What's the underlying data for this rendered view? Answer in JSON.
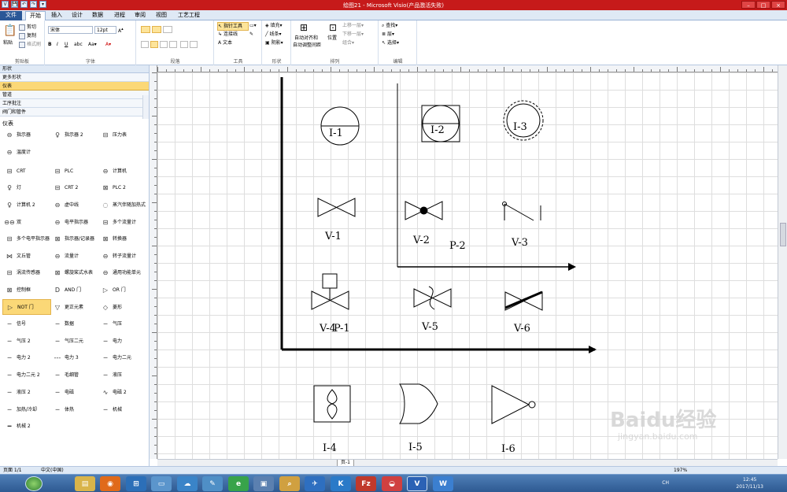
{
  "window": {
    "title": "绘图21 - Microsoft Visio(产品激活失败)"
  },
  "qat": [
    "💾",
    "↶",
    "↷",
    "▾"
  ],
  "tabs": [
    "文件",
    "开始",
    "插入",
    "设计",
    "数据",
    "进程",
    "审阅",
    "视图",
    "工艺工程"
  ],
  "ribbon": {
    "clipboard": {
      "paste": "粘贴",
      "cut": "剪切",
      "copy": "复制",
      "format_painter": "格式刷",
      "label": "剪贴板"
    },
    "font": {
      "family": "宋体",
      "size": "12pt",
      "label": "字体",
      "buttons": [
        "B",
        "I",
        "U",
        "abc",
        "Aa▾",
        "A▾"
      ]
    },
    "paragraph": {
      "label": "段落"
    },
    "tools": {
      "pointer": "指针工具",
      "connector": "连接线",
      "text": "文本",
      "label": "工具"
    },
    "shape": {
      "fill": "填充▾",
      "line": "线条▾",
      "shadow": "阴影▾",
      "label": "形状"
    },
    "arrange": {
      "auto_align": "自动对齐和",
      "auto_space": "自动调整间距",
      "position": "位置",
      "bring_forward": "上移一层▾",
      "send_backward": "下移一层▾",
      "group": "组合▾",
      "label": "排列"
    },
    "editing": {
      "find": "查找▾",
      "layers": "层▾",
      "select": "选择▾",
      "label": "编辑"
    }
  },
  "shapes_panel": {
    "header": "形状",
    "more_shapes": "更多形状",
    "stencils": [
      "仪表",
      "管道",
      "工序批注",
      "阀门和管件"
    ],
    "selected_stencil": "仪表",
    "section_title": "仪表",
    "items": [
      {
        "label": "指示器",
        "icon": "⊖"
      },
      {
        "label": "指示器 2",
        "icon": "♀"
      },
      {
        "label": "压力表",
        "icon": "⊟"
      },
      {
        "label": "温度计",
        "icon": "⊖"
      },
      {
        "label": "CRT",
        "icon": "⊟"
      },
      {
        "label": "PLC",
        "icon": "⊟"
      },
      {
        "label": "计算机",
        "icon": "⊖"
      },
      {
        "label": "灯",
        "icon": "♀"
      },
      {
        "label": "CRT 2",
        "icon": "⊟"
      },
      {
        "label": "PLC 2",
        "icon": "⊠"
      },
      {
        "label": "计算机 2",
        "icon": "♀"
      },
      {
        "label": "虚中线",
        "icon": "⊖"
      },
      {
        "label": "蒸汽伴随加热式",
        "icon": "◌"
      },
      {
        "label": "双",
        "icon": "⊖⊖"
      },
      {
        "label": "电平指示器",
        "icon": "⊖"
      },
      {
        "label": "多个流量计",
        "icon": "⊟"
      },
      {
        "label": "多个电平指示器",
        "icon": "⊟"
      },
      {
        "label": "指示器/记录器",
        "icon": "⊠"
      },
      {
        "label": "转换器",
        "icon": "⊠"
      },
      {
        "label": "文丘管",
        "icon": "⋈"
      },
      {
        "label": "流量计",
        "icon": "⊖"
      },
      {
        "label": "转子流量计",
        "icon": "⊖"
      },
      {
        "label": "涡流传感器",
        "icon": "⊟"
      },
      {
        "label": "螺旋桨式水表",
        "icon": "⊠"
      },
      {
        "label": "通用功能单元",
        "icon": "⊖"
      },
      {
        "label": "控制框",
        "icon": "⊠"
      },
      {
        "label": "AND 门",
        "icon": "D"
      },
      {
        "label": "OR 门",
        "icon": "▷"
      },
      {
        "label": "NOT 门",
        "icon": "▷"
      },
      {
        "label": "更正元素",
        "icon": "▽"
      },
      {
        "label": "菱形",
        "icon": "◇"
      },
      {
        "label": "信号",
        "icon": "─"
      },
      {
        "label": "数据",
        "icon": "─"
      },
      {
        "label": "气压",
        "icon": "─"
      },
      {
        "label": "气压 2",
        "icon": "─"
      },
      {
        "label": "气压二元",
        "icon": "─"
      },
      {
        "label": "电力",
        "icon": "─"
      },
      {
        "label": "电力 2",
        "icon": "─"
      },
      {
        "label": "电力 3",
        "icon": "---"
      },
      {
        "label": "电力二元",
        "icon": "─"
      },
      {
        "label": "电力二元 2",
        "icon": "─"
      },
      {
        "label": "毛细管",
        "icon": "─"
      },
      {
        "label": "液压",
        "icon": "─"
      },
      {
        "label": "液压 2",
        "icon": "─"
      },
      {
        "label": "电磁",
        "icon": "─"
      },
      {
        "label": "电磁 2",
        "icon": "∿"
      },
      {
        "label": "加热/冷却",
        "icon": "─"
      },
      {
        "label": "体热",
        "icon": "─"
      },
      {
        "label": "机械",
        "icon": "─"
      },
      {
        "label": "机械 2",
        "icon": "━"
      }
    ],
    "selected_item": "NOT 门"
  },
  "diagram": {
    "labels": {
      "i1": "I-1",
      "i2": "I-2",
      "i3": "I-3",
      "v1": "V-1",
      "v2": "V-2",
      "p2": "P-2",
      "v3": "V-3",
      "v4": "V-4",
      "p1": "P-1",
      "v5": "V-5",
      "v6": "V-6",
      "i4": "I-4",
      "i5": "I-5",
      "i6": "I-6"
    }
  },
  "pagetab": "页-1",
  "status": {
    "page": "页面 1/1",
    "language": "中文(中国)",
    "zoom": "197%"
  },
  "taskbar": {
    "time": "12:45",
    "date": "2017/11/13",
    "lang": "CH"
  },
  "watermark": {
    "main": "Baidu经验",
    "url": "jingyan.baidu.com"
  }
}
